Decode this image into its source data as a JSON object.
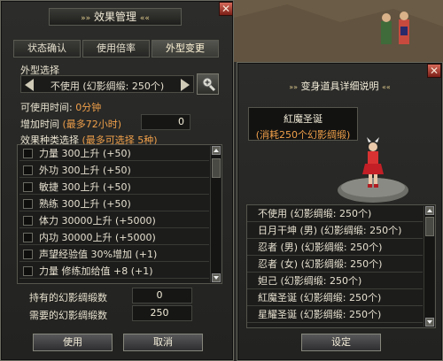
{
  "left_window": {
    "title": "效果管理",
    "tabs": [
      "状态确认",
      "使用倍率",
      "外型变更"
    ],
    "appearance_select_label": "外型选择",
    "appearance_selected": "不使用 (幻影绸缎: 250个)",
    "usable_time_label": "可使用时间:",
    "usable_time_value": "0分钟",
    "add_time_label": "增加时间",
    "add_time_hint": "(最多72小时)",
    "add_time_value": "0",
    "effect_type_label": "效果种类选择",
    "effect_type_hint": "(最多可选择 5种)",
    "effects": [
      "力量  300上升  (+50)",
      "外功  300上升  (+50)",
      "敏捷  300上升  (+50)",
      "熟练  300上升  (+50)",
      "体力  30000上升  (+5000)",
      "内功  30000上升  (+5000)",
      "声望经验值  30%增加  (+1)",
      "力量  修练加给值  +8  (+1)"
    ],
    "owned_label": "持有的幻影绸缎数",
    "owned_value": "0",
    "required_label": "需要的幻影绸缎数",
    "required_value": "250",
    "use_button": "使用",
    "cancel_button": "取消",
    "close_glyph": "✕"
  },
  "right_window": {
    "title": "变身道具详细说明",
    "item_name": "紅魔圣诞",
    "item_cost": "(消耗250个幻影绸缎)",
    "costumes": [
      "不使用 (幻影绸缎: 250个)",
      "日月干坤 (男) (幻影绸缎: 250个)",
      "忍者 (男) (幻影绸缎: 250个)",
      "忍者 (女) (幻影绸缎: 250个)",
      "妲己 (幻影绸缎: 250个)",
      "紅魔圣诞 (幻影绸缎: 250个)",
      "星耀圣诞 (幻影绸缎: 250个)"
    ],
    "set_button": "设定",
    "close_glyph": "✕"
  },
  "decor": {
    "title_left": "»",
    "title_right": "«",
    "title_left_small": "»»",
    "title_right_small": "««"
  }
}
